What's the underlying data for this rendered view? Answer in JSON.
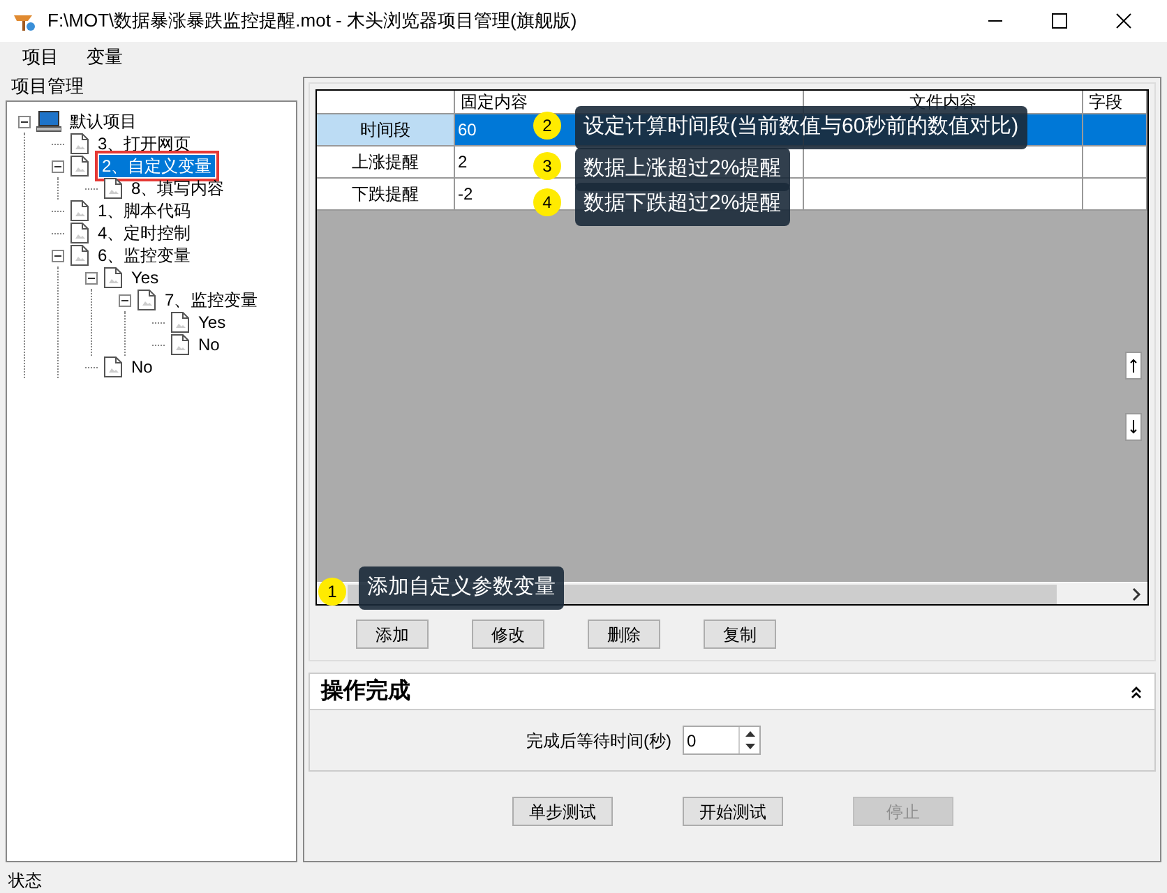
{
  "window": {
    "title": "F:\\MOT\\数据暴涨暴跌监控提醒.mot  - 木头浏览器项目管理(旗舰版)"
  },
  "menu": [
    "项目",
    "变量"
  ],
  "sidebar": {
    "title": "项目管理",
    "tree": [
      {
        "label": "默认项目",
        "kind": "project",
        "expanded": true,
        "selected": false,
        "children": [
          {
            "label": "3、打开网页",
            "kind": "node",
            "selected": false
          },
          {
            "label": "2、自定义变量",
            "kind": "node",
            "expanded": true,
            "selected": true,
            "annotated": true,
            "children": [
              {
                "label": "8、填写内容",
                "kind": "node",
                "selected": false
              }
            ]
          },
          {
            "label": "1、脚本代码",
            "kind": "node",
            "selected": false
          },
          {
            "label": "4、定时控制",
            "kind": "node",
            "selected": false
          },
          {
            "label": "6、监控变量",
            "kind": "node",
            "expanded": true,
            "selected": false,
            "children": [
              {
                "label": "Yes",
                "kind": "node",
                "expanded": true,
                "selected": false,
                "children": [
                  {
                    "label": "7、监控变量",
                    "kind": "node",
                    "expanded": true,
                    "selected": false,
                    "children": [
                      {
                        "label": "Yes",
                        "kind": "node",
                        "selected": false
                      },
                      {
                        "label": "No",
                        "kind": "node",
                        "selected": false
                      }
                    ]
                  }
                ]
              },
              {
                "label": "No",
                "kind": "node",
                "selected": false
              }
            ]
          }
        ]
      }
    ]
  },
  "table": {
    "columns": [
      "固定内容",
      "文件内容",
      "字段"
    ],
    "rows": [
      {
        "name": "时间段",
        "cells": [
          "60",
          "",
          ""
        ],
        "selected": true
      },
      {
        "name": "上涨提醒",
        "cells": [
          "2",
          "",
          ""
        ],
        "selected": false
      },
      {
        "name": "下跌提醒",
        "cells": [
          "-2",
          "",
          ""
        ],
        "selected": false
      }
    ]
  },
  "annotations": [
    {
      "number": "2",
      "text": "设定计算时间段(当前数值与60秒前的数值对比)"
    },
    {
      "number": "3",
      "text": "数据上涨超过2%提醒"
    },
    {
      "number": "4",
      "text": "数据下跌超过2%提醒"
    },
    {
      "number": "1",
      "text": "添加自定义参数变量"
    }
  ],
  "table_buttons": [
    "添加",
    "修改",
    "删除",
    "复制"
  ],
  "section": {
    "title": "操作完成",
    "expanded": true,
    "wait_label": "完成后等待时间(秒)",
    "wait_value": "0"
  },
  "actions": [
    {
      "label": "单步测试",
      "disabled": false
    },
    {
      "label": "开始测试",
      "disabled": false
    },
    {
      "label": "停止",
      "disabled": true
    }
  ],
  "status_bar": "状态"
}
